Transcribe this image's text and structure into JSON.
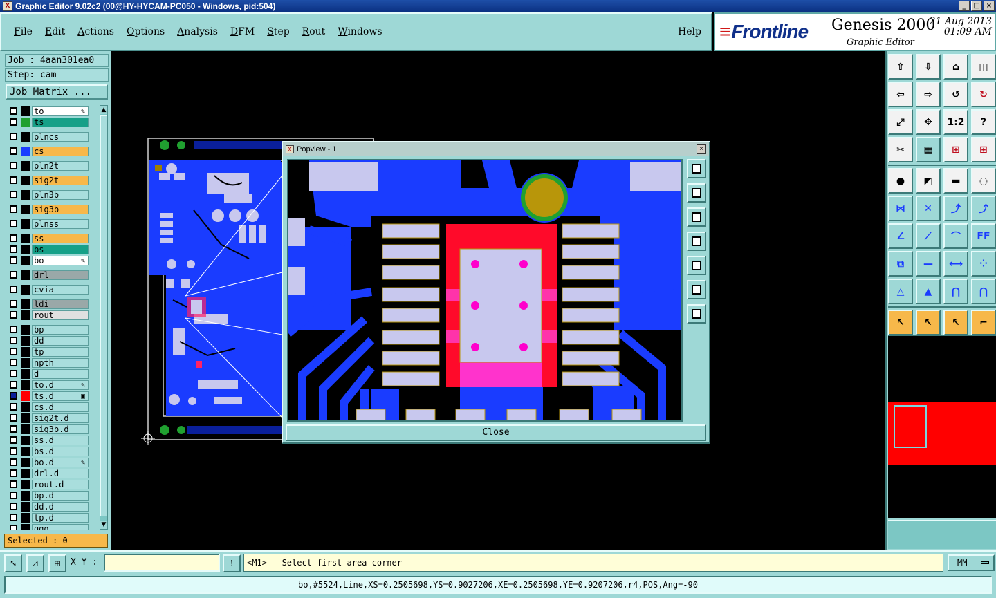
{
  "window": {
    "title": "Graphic Editor 9.02c2 (00@HY-HYCAM-PC050 - Windows, pid:504)",
    "buttons": [
      "_",
      "□",
      "×"
    ]
  },
  "menu": {
    "items": [
      "File",
      "Edit",
      "Actions",
      "Options",
      "Analysis",
      "DFM",
      "Step",
      "Rout",
      "Windows"
    ],
    "help": "Help"
  },
  "brand": {
    "logo": "Frontline",
    "product": "Genesis 2000",
    "subtitle": "Graphic Editor",
    "date": "21 Aug 2013",
    "time": "01:09 AM"
  },
  "job": {
    "job_line": "Job : 4aan301ea0",
    "step_line": "Step: cam",
    "matrix_button": "Job Matrix ..."
  },
  "layers": [
    {
      "name": "to",
      "label_bg": "#ffffff",
      "swatch": "#000000",
      "mark": "✎"
    },
    {
      "name": "ts",
      "label_bg": "#16a088",
      "swatch": "#20a030",
      "mark": ""
    },
    {
      "name": "plncs",
      "label_bg": "#a9dedd",
      "swatch": "#000000",
      "mark": ""
    },
    {
      "name": "cs",
      "label_bg": "#f7b84a",
      "swatch": "#1a3cff",
      "mark": ""
    },
    {
      "name": "pln2t",
      "label_bg": "#a9dedd",
      "swatch": "#000000",
      "mark": ""
    },
    {
      "name": "sig2t",
      "label_bg": "#f7b84a",
      "swatch": "#000000",
      "mark": ""
    },
    {
      "name": "pln3b",
      "label_bg": "#a9dedd",
      "swatch": "#000000",
      "mark": ""
    },
    {
      "name": "sig3b",
      "label_bg": "#f7b84a",
      "swatch": "#000000",
      "mark": ""
    },
    {
      "name": "plnss",
      "label_bg": "#a9dedd",
      "swatch": "#000000",
      "mark": ""
    },
    {
      "name": "ss",
      "label_bg": "#f7b84a",
      "swatch": "#000000",
      "mark": ""
    },
    {
      "name": "bs",
      "label_bg": "#16a088",
      "swatch": "#000000",
      "mark": ""
    },
    {
      "name": "bo",
      "label_bg": "#ffffff",
      "swatch": "#000000",
      "mark": "✎"
    },
    {
      "name": "drl",
      "label_bg": "#9aa8a8",
      "swatch": "#000000",
      "mark": ""
    },
    {
      "name": "cvia",
      "label_bg": "#a9dedd",
      "swatch": "#000000",
      "mark": ""
    },
    {
      "name": "ldi",
      "label_bg": "#9aa8a8",
      "swatch": "#000000",
      "mark": ""
    },
    {
      "name": "rout",
      "label_bg": "#e0e0e0",
      "swatch": "#000000",
      "mark": ""
    },
    {
      "name": "bp",
      "label_bg": "#a9dedd",
      "swatch": "#000000",
      "mark": ""
    },
    {
      "name": "dd",
      "label_bg": "#a9dedd",
      "swatch": "#000000",
      "mark": ""
    },
    {
      "name": "tp",
      "label_bg": "#a9dedd",
      "swatch": "#000000",
      "mark": ""
    },
    {
      "name": "npth",
      "label_bg": "#a9dedd",
      "swatch": "#000000",
      "mark": ""
    },
    {
      "name": "d",
      "label_bg": "#a9dedd",
      "swatch": "#000000",
      "mark": ""
    },
    {
      "name": "to.d",
      "label_bg": "#a9dedd",
      "swatch": "#000000",
      "mark": "✎"
    },
    {
      "name": "ts.d",
      "label_bg": "#a9dedd",
      "swatch": "#ff0000",
      "mark": "▣"
    },
    {
      "name": "cs.d",
      "label_bg": "#a9dedd",
      "swatch": "#000000",
      "mark": ""
    },
    {
      "name": "sig2t.d",
      "label_bg": "#a9dedd",
      "swatch": "#000000",
      "mark": ""
    },
    {
      "name": "sig3b.d",
      "label_bg": "#a9dedd",
      "swatch": "#000000",
      "mark": ""
    },
    {
      "name": "ss.d",
      "label_bg": "#a9dedd",
      "swatch": "#000000",
      "mark": ""
    },
    {
      "name": "bs.d",
      "label_bg": "#a9dedd",
      "swatch": "#000000",
      "mark": ""
    },
    {
      "name": "bo.d",
      "label_bg": "#a9dedd",
      "swatch": "#000000",
      "mark": "✎"
    },
    {
      "name": "drl.d",
      "label_bg": "#a9dedd",
      "swatch": "#000000",
      "mark": ""
    },
    {
      "name": "rout.d",
      "label_bg": "#a9dedd",
      "swatch": "#000000",
      "mark": ""
    },
    {
      "name": "bp.d",
      "label_bg": "#a9dedd",
      "swatch": "#000000",
      "mark": ""
    },
    {
      "name": "dd.d",
      "label_bg": "#a9dedd",
      "swatch": "#000000",
      "mark": ""
    },
    {
      "name": "tp.d",
      "label_bg": "#a9dedd",
      "swatch": "#000000",
      "mark": ""
    },
    {
      "name": "ggg",
      "label_bg": "#a9dedd",
      "swatch": "#000000",
      "mark": ""
    }
  ],
  "selected_text": "Selected : 0",
  "popview": {
    "title": "Popview - 1",
    "close_label": "Close"
  },
  "toolbar": {
    "tools": [
      {
        "icon": "upload-icon",
        "glyph": "⇧",
        "style": "w"
      },
      {
        "icon": "download-icon",
        "glyph": "⇩",
        "style": "w"
      },
      {
        "icon": "home-icon",
        "glyph": "⌂",
        "style": "w"
      },
      {
        "icon": "split-icon",
        "glyph": "◫",
        "style": "w"
      },
      {
        "icon": "pan-left-icon",
        "glyph": "⇦",
        "style": "w"
      },
      {
        "icon": "pan-right-icon",
        "glyph": "⇨",
        "style": "w"
      },
      {
        "icon": "undo-icon",
        "glyph": "↺",
        "style": "w"
      },
      {
        "icon": "redo-icon",
        "glyph": "↻",
        "style": "w"
      },
      {
        "icon": "zoom-fit-icon",
        "glyph": "⤢",
        "style": "w"
      },
      {
        "icon": "zoom-center-icon",
        "glyph": "✥",
        "style": "w"
      },
      {
        "icon": "scale-1-2-icon",
        "glyph": "1:2",
        "style": "w"
      },
      {
        "icon": "help-icon",
        "glyph": "?",
        "style": "w"
      },
      {
        "icon": "tweezers-icon",
        "glyph": "✂",
        "style": "w"
      },
      {
        "icon": "grid-icon",
        "glyph": "▦",
        "style": "t"
      },
      {
        "icon": "layers-red-icon",
        "glyph": "⊞",
        "style": "w"
      },
      {
        "icon": "layers-red-2-icon",
        "glyph": "⊞",
        "style": "w"
      },
      {
        "icon": "pad-add-icon",
        "glyph": "●",
        "style": "w"
      },
      {
        "icon": "line-add-icon",
        "glyph": "◩",
        "style": "w"
      },
      {
        "icon": "ruler-icon",
        "glyph": "▬",
        "style": "w"
      },
      {
        "icon": "dashed-circle-icon",
        "glyph": "◌",
        "style": "w"
      },
      {
        "icon": "connect-icon",
        "glyph": "⋈",
        "style": "t"
      },
      {
        "icon": "cross-icon",
        "glyph": "✕",
        "style": "t"
      },
      {
        "icon": "move-pad-icon",
        "glyph": "⤴",
        "style": "t"
      },
      {
        "icon": "move-pad-2-icon",
        "glyph": "⤴",
        "style": "t"
      },
      {
        "icon": "angle-icon",
        "glyph": "∠",
        "style": "t"
      },
      {
        "icon": "line-edit-icon",
        "glyph": "⟋",
        "style": "t"
      },
      {
        "icon": "arc-icon",
        "glyph": "⌒",
        "style": "t"
      },
      {
        "icon": "ff-icon",
        "glyph": "FF",
        "style": "t"
      },
      {
        "icon": "pad-move-icon",
        "glyph": "⧉",
        "style": "t"
      },
      {
        "icon": "minus-icon",
        "glyph": "—",
        "style": "t"
      },
      {
        "icon": "measure-icon",
        "glyph": "⟷",
        "style": "t"
      },
      {
        "icon": "group-icon",
        "glyph": "⁘",
        "style": "t"
      },
      {
        "icon": "triangle-icon",
        "glyph": "△",
        "style": "t"
      },
      {
        "icon": "triangle-2-icon",
        "glyph": "▲",
        "style": "t"
      },
      {
        "icon": "arch-icon",
        "glyph": "⋂",
        "style": "t"
      },
      {
        "icon": "arch-2-icon",
        "glyph": "⋂",
        "style": "t"
      },
      {
        "icon": "select-icon",
        "glyph": "↖",
        "style": "o"
      },
      {
        "icon": "select-box-icon",
        "glyph": "↖",
        "style": "o"
      },
      {
        "icon": "select-poly-icon",
        "glyph": "↖",
        "style": "o"
      },
      {
        "icon": "route-icon",
        "glyph": "⌐",
        "style": "o"
      }
    ]
  },
  "command": {
    "xy_label": "X Y :",
    "xy_value": "",
    "message": "<M1> - Select first area corner",
    "units": "MM"
  },
  "status": "bo,#5524,Line,XS=0.2505698,YS=0.9027206,XE=0.2505698,YE=0.9207206,r4,POS,Ang=-90"
}
